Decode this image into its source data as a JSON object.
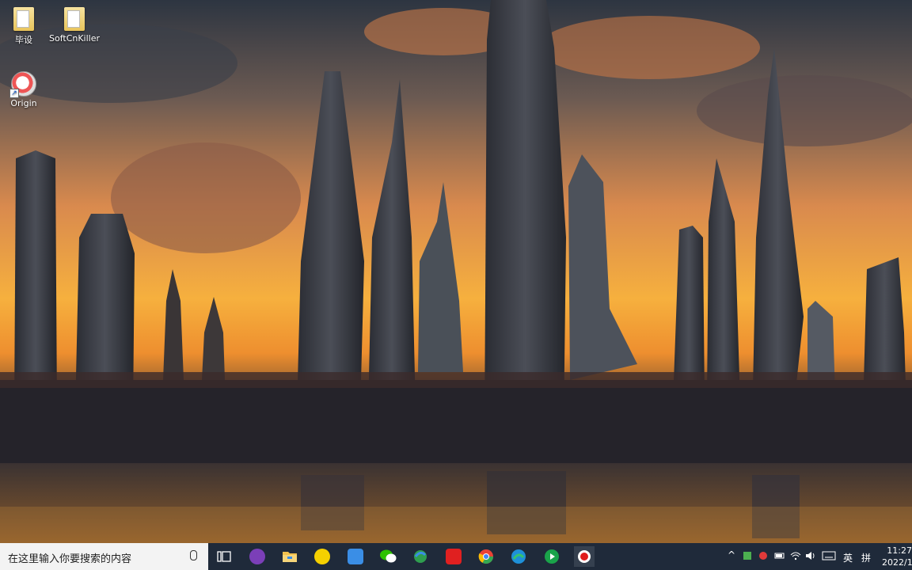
{
  "desktop": {
    "icons": [
      {
        "label": "毕设",
        "icon": "folder-icon"
      },
      {
        "label": "SoftCnKiller",
        "icon": "folder-icon"
      },
      {
        "label": "Origin",
        "icon": "origin-app-icon"
      }
    ]
  },
  "taskbar": {
    "search_placeholder": "在这里输入你要搜索的内容",
    "apps": [
      {
        "name": "task-view-icon",
        "color": "#ffffff"
      },
      {
        "name": "purple-app-icon",
        "color": "#7b3fb8"
      },
      {
        "name": "file-explorer-icon",
        "color": "#f2c14e"
      },
      {
        "name": "yellow-app-icon",
        "color": "#f5d000"
      },
      {
        "name": "blue-app-icon",
        "color": "#3a8ee6"
      },
      {
        "name": "wechat-icon",
        "color": "#2dc100"
      },
      {
        "name": "globe-browser-icon",
        "color": "#2f9e4f"
      },
      {
        "name": "youdao-icon",
        "color": "#e02020"
      },
      {
        "name": "chrome-icon",
        "color": "#ea4335"
      },
      {
        "name": "edge-icon",
        "color": "#1e90d8"
      },
      {
        "name": "play-app-icon",
        "color": "#1aa34a"
      },
      {
        "name": "record-app-icon",
        "color": "#e01b1b"
      }
    ],
    "tray": {
      "ime_label": "英",
      "ime2_label": "拼"
    },
    "clock": {
      "time": "11:27",
      "date": "2022/1/"
    }
  }
}
